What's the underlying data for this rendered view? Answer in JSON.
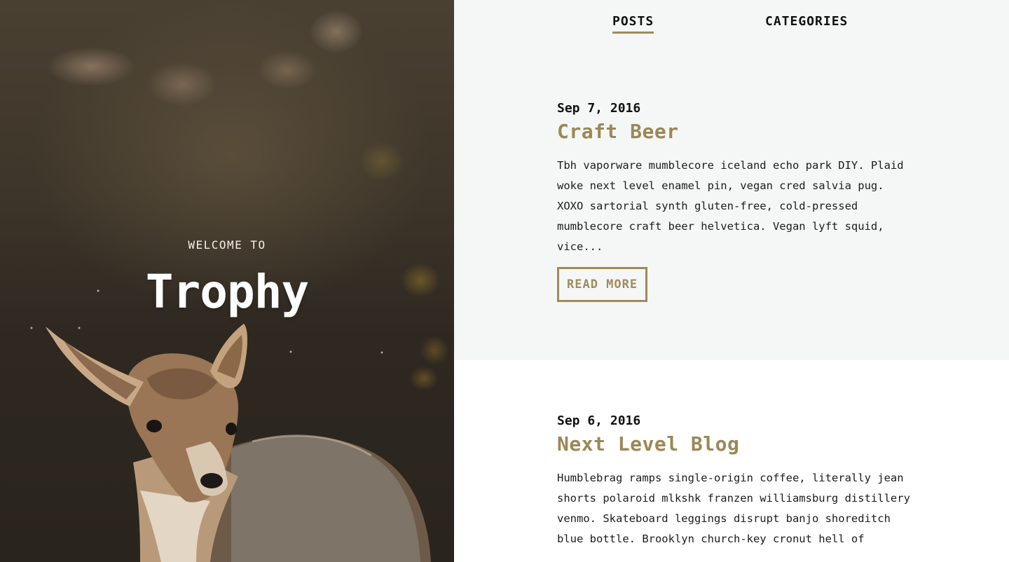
{
  "hero": {
    "welcome": "WELCOME TO",
    "title": "Trophy",
    "image_subject": "deer-photo"
  },
  "nav": {
    "tabs": [
      {
        "label": "POSTS",
        "active": true
      },
      {
        "label": "CATEGORIES",
        "active": false
      }
    ]
  },
  "posts": [
    {
      "date": "Sep 7, 2016",
      "title": "Craft Beer",
      "excerpt": "Tbh vaporware mumblecore iceland echo park DIY. Plaid woke next level enamel pin, vegan cred salvia pug. XOXO sartorial synth gluten-free, cold-pressed mumblecore craft beer helvetica. Vegan lyft squid, vice...",
      "button": "READ MORE"
    },
    {
      "date": "Sep 6, 2016",
      "title": "Next Level Blog",
      "excerpt": "Humblebrag ramps single-origin coffee, literally jean shorts polaroid mlkshk franzen williamsburg distillery venmo. Skateboard leggings disrupt banjo shoreditch blue bottle. Brooklyn church-key cronut hell of"
    }
  ],
  "colors": {
    "accent": "#a08a5a",
    "post_bg_alt": "#f5f7f6",
    "text": "#111111"
  }
}
